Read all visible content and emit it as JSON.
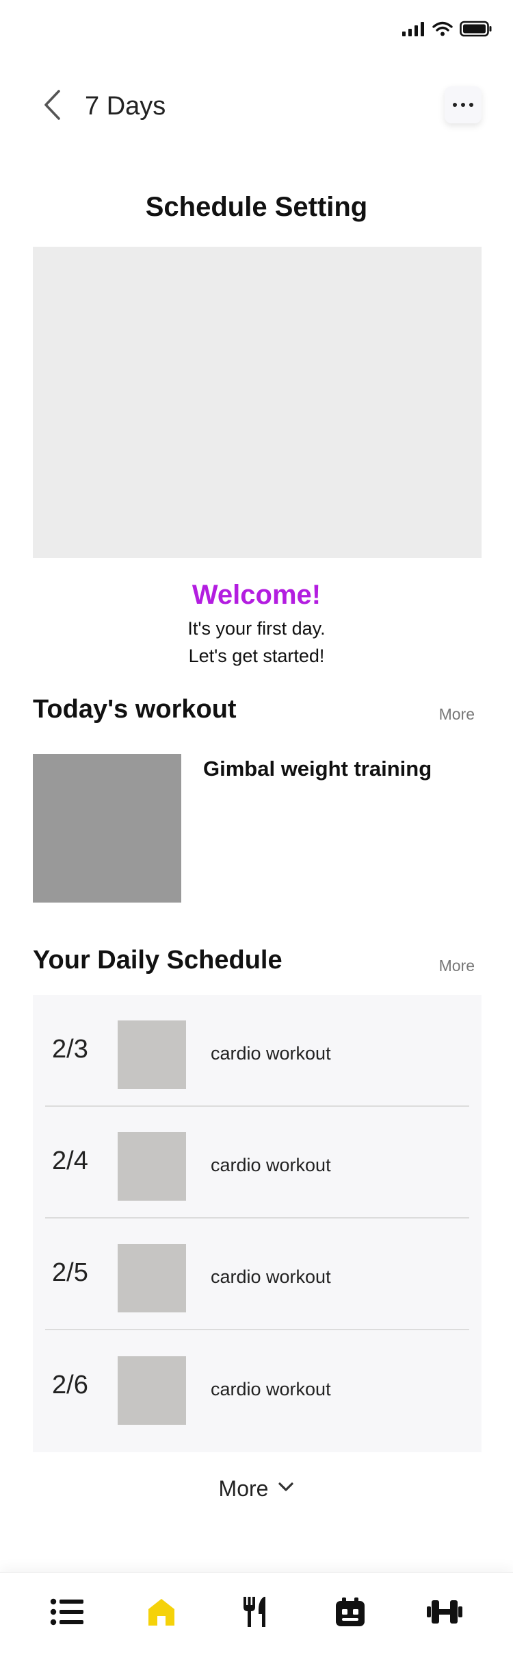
{
  "status_bar": {
    "icons": [
      "signal-icon",
      "wifi-icon",
      "battery-icon"
    ]
  },
  "nav": {
    "title": "7 Days",
    "back_icon": "chevron-left-icon",
    "menu_icon": "more-horizontal-icon"
  },
  "page": {
    "heading": "Schedule Setting"
  },
  "welcome": {
    "title": "Welcome!",
    "line1": "It's your first day.",
    "line2": "Let's get started!",
    "accent_color": "#b31de0"
  },
  "todays_workout": {
    "title": "Today's workout",
    "more_label": "More",
    "item_name": "Gimbal weight training"
  },
  "daily_schedule": {
    "title": "Your Daily Schedule",
    "more_label": "More",
    "items": [
      {
        "date": "2/3",
        "label": "cardio workout"
      },
      {
        "date": "2/4",
        "label": "cardio workout"
      },
      {
        "date": "2/5",
        "label": "cardio workout"
      },
      {
        "date": "2/6",
        "label": "cardio workout"
      }
    ],
    "show_more_label": "More",
    "show_more_icon": "chevron-down-icon"
  },
  "tab_bar": {
    "active_color": "#f5d20a",
    "tabs": [
      {
        "icon": "list-icon",
        "active": false
      },
      {
        "icon": "home-icon",
        "active": true
      },
      {
        "icon": "fork-knife-icon",
        "active": false
      },
      {
        "icon": "calendar-icon",
        "active": false
      },
      {
        "icon": "dumbbell-icon",
        "active": false
      }
    ]
  }
}
